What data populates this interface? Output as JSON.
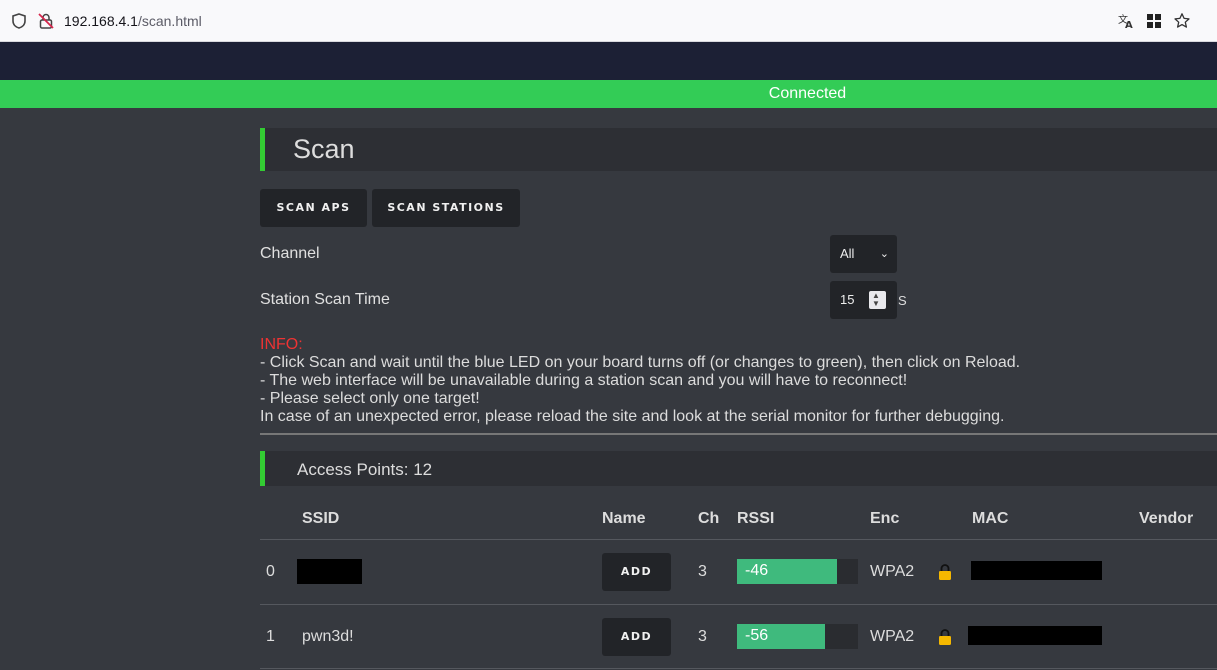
{
  "browser": {
    "url_host": "192.168.4.1",
    "url_path": "/scan.html"
  },
  "status": "Connected",
  "scan": {
    "title": "Scan",
    "buttons": {
      "scan_aps": "SCAN APS",
      "scan_stations": "SCAN STATIONS"
    },
    "channel_label": "Channel",
    "channel_value": "All",
    "station_scan_time_label": "Station Scan Time",
    "station_scan_time_value": "15",
    "station_scan_time_unit": "S"
  },
  "info": {
    "heading": "INFO:",
    "lines": [
      "- Click Scan and wait until the blue LED on your board turns off (or changes to green), then click on Reload.",
      "- The web interface will be unavailable during a station scan and you will have to reconnect!",
      "- Please select only one target!",
      "In case of an unexpected error, please reload the site and look at the serial monitor for further debugging."
    ]
  },
  "access_points": {
    "title": "Access Points: 12",
    "columns": [
      "SSID",
      "Name",
      "Ch",
      "RSSI",
      "Enc",
      "MAC",
      "Vendor"
    ],
    "rows": [
      {
        "index": "0",
        "ssid": "",
        "name_action": "ADD",
        "ch": "3",
        "rssi": "-46",
        "rssi_level": 0.83,
        "enc": "WPA2"
      },
      {
        "index": "1",
        "ssid": "pwn3d!",
        "name_action": "ADD",
        "ch": "3",
        "rssi": "-56",
        "rssi_level": 0.73,
        "enc": "WPA2"
      }
    ]
  },
  "colors": {
    "connected": "#33cc56",
    "accent": "#33cc33",
    "rssi": "#3fba7d",
    "info": "#ee3333",
    "lock": "#f5b800"
  }
}
